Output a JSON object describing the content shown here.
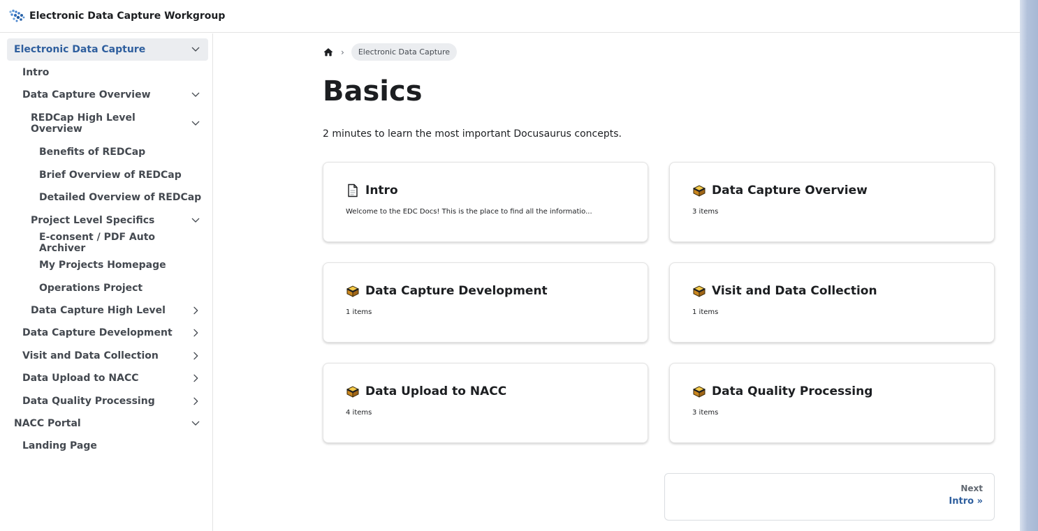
{
  "navbar": {
    "title": "Electronic Data Capture Workgroup",
    "logo_icon": "molecule-logo-icon"
  },
  "sidebar": {
    "items": [
      {
        "label": "Electronic Data Capture",
        "level": 0,
        "caret": "down",
        "active": true
      },
      {
        "label": "Intro",
        "level": 1,
        "caret": ""
      },
      {
        "label": "Data Capture Overview",
        "level": 1,
        "caret": "down"
      },
      {
        "label": "REDCap High Level Overview",
        "level": 2,
        "caret": "down",
        "tall": true
      },
      {
        "label": "Benefits of REDCap",
        "level": 3,
        "caret": ""
      },
      {
        "label": "Brief Overview of REDCap",
        "level": 3,
        "caret": ""
      },
      {
        "label": "Detailed Overview of REDCap",
        "level": 3,
        "caret": ""
      },
      {
        "label": "Project Level Specifics",
        "level": 2,
        "caret": "down"
      },
      {
        "label": "E-consent / PDF Auto Archiver",
        "level": 3,
        "caret": ""
      },
      {
        "label": "My Projects Homepage",
        "level": 3,
        "caret": ""
      },
      {
        "label": "Operations Project",
        "level": 3,
        "caret": ""
      },
      {
        "label": "Data Capture High Level",
        "level": 2,
        "caret": "right"
      },
      {
        "label": "Data Capture Development",
        "level": 1,
        "caret": "right"
      },
      {
        "label": "Visit and Data Collection",
        "level": 1,
        "caret": "right"
      },
      {
        "label": "Data Upload to NACC",
        "level": 1,
        "caret": "right"
      },
      {
        "label": "Data Quality Processing",
        "level": 1,
        "caret": "right"
      },
      {
        "label": "NACC Portal",
        "level": 0,
        "caret": "down"
      },
      {
        "label": "Landing Page",
        "level": 1,
        "caret": ""
      }
    ]
  },
  "breadcrumb": {
    "home_icon": "home-icon",
    "current": "Electronic Data Capture"
  },
  "page": {
    "title": "Basics",
    "subtitle": "2 minutes to learn the most important Docusaurus concepts."
  },
  "cards": [
    {
      "icon": "document-icon",
      "title": "Intro",
      "desc": "Welcome to the EDC Docs! This is the place to find all the informatio..."
    },
    {
      "icon": "box-icon",
      "title": "Data Capture Overview",
      "desc": "3 items"
    },
    {
      "icon": "box-icon",
      "title": "Data Capture Development",
      "desc": "1 items"
    },
    {
      "icon": "box-icon",
      "title": "Visit and Data Collection",
      "desc": "1 items"
    },
    {
      "icon": "box-icon",
      "title": "Data Upload to NACC",
      "desc": "4 items"
    },
    {
      "icon": "box-icon",
      "title": "Data Quality Processing",
      "desc": "3 items"
    }
  ],
  "pager": {
    "sub": "Next",
    "label": "Intro »"
  },
  "colors": {
    "link": "#2f5f9e",
    "text": "#1c1e21",
    "muted": "#444950",
    "active_bg": "#ebedf0"
  }
}
